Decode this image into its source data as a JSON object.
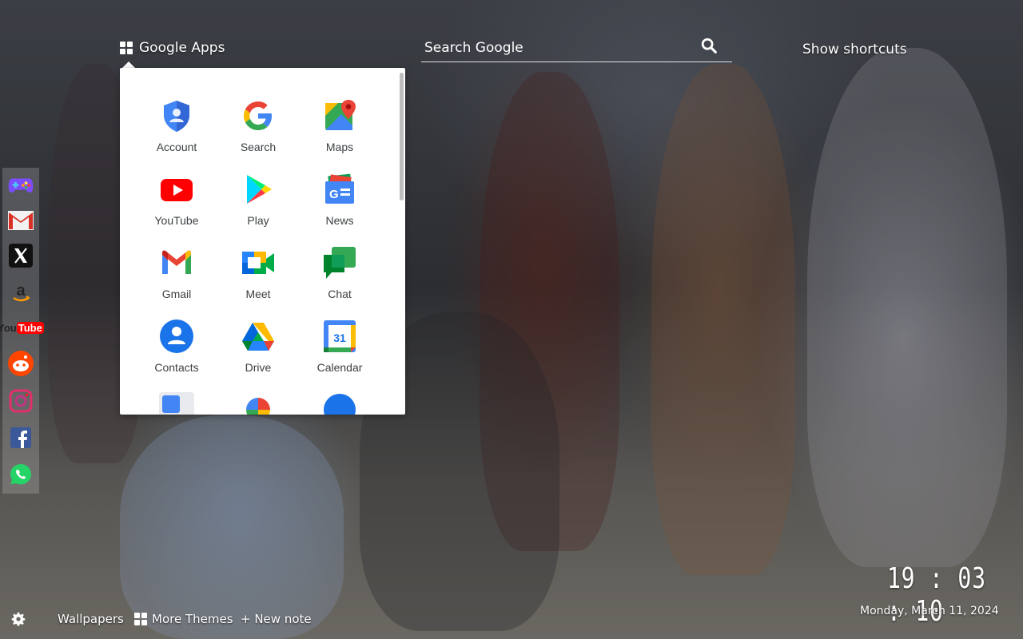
{
  "header": {
    "apps_label": "Google Apps",
    "search_placeholder": "Search Google",
    "shortcuts_label": "Show shortcuts"
  },
  "apps": [
    {
      "label": "Account",
      "icon": "account-icon"
    },
    {
      "label": "Search",
      "icon": "google-search-icon"
    },
    {
      "label": "Maps",
      "icon": "maps-icon"
    },
    {
      "label": "YouTube",
      "icon": "youtube-icon"
    },
    {
      "label": "Play",
      "icon": "play-icon"
    },
    {
      "label": "News",
      "icon": "news-icon"
    },
    {
      "label": "Gmail",
      "icon": "gmail-icon"
    },
    {
      "label": "Meet",
      "icon": "meet-icon"
    },
    {
      "label": "Chat",
      "icon": "chat-icon"
    },
    {
      "label": "Contacts",
      "icon": "contacts-icon"
    },
    {
      "label": "Drive",
      "icon": "drive-icon"
    },
    {
      "label": "Calendar",
      "icon": "calendar-icon"
    }
  ],
  "calendar_day": "31",
  "sidebar": [
    "games-icon",
    "gmail-icon",
    "x-icon",
    "amazon-icon",
    "youtube-icon",
    "reddit-icon",
    "instagram-icon",
    "facebook-icon",
    "whatsapp-icon"
  ],
  "sidebar_youtube_text": "You",
  "sidebar_youtube_tube": "Tube",
  "footer": {
    "wallpapers": "Wallpapers",
    "more_themes": "More Themes",
    "new_note": "+ New note",
    "settings_icon": "gear-icon"
  },
  "clock": {
    "time": "19 : 03 : 10",
    "date": "Monday, March 11, 2024"
  }
}
